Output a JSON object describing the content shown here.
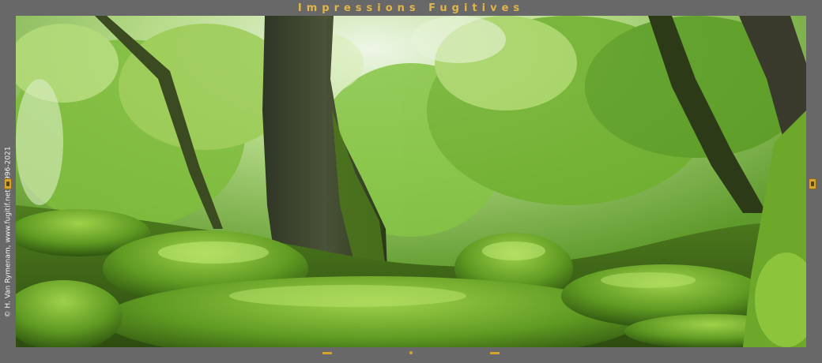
{
  "frame": {
    "title": "Impressions Fugitives",
    "copyright": "© H. Van Rymenam,  www.fugitif.net,  1996-2021"
  },
  "photo": {
    "subject": "forest-photo"
  },
  "colors": {
    "frame_background": "#686868",
    "title_accent": "#e0b54a",
    "ornament": "#d4a42c"
  },
  "icons": {
    "left_clip": "frame-clip-icon",
    "right_clip": "frame-clip-icon"
  }
}
